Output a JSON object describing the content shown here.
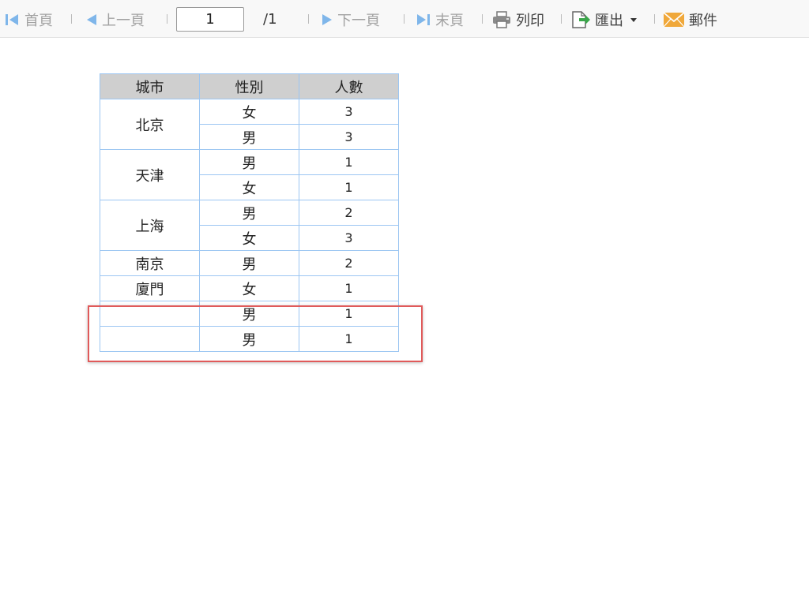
{
  "toolbar": {
    "first_label": "首頁",
    "prev_label": "上一頁",
    "page_input_value": "1",
    "page_total": "/1",
    "next_label": "下一頁",
    "last_label": "末頁",
    "print_label": "列印",
    "export_label": "匯出",
    "mail_label": "郵件"
  },
  "table": {
    "headers": [
      "城市",
      "性別",
      "人數"
    ],
    "groups": [
      {
        "city": "北京",
        "rows": [
          {
            "gender": "女",
            "count": "3"
          },
          {
            "gender": "男",
            "count": "3"
          }
        ]
      },
      {
        "city": "天津",
        "rows": [
          {
            "gender": "男",
            "count": "1"
          },
          {
            "gender": "女",
            "count": "1"
          }
        ]
      },
      {
        "city": "上海",
        "rows": [
          {
            "gender": "男",
            "count": "2"
          },
          {
            "gender": "女",
            "count": "3"
          }
        ]
      },
      {
        "city": "南京",
        "rows": [
          {
            "gender": "男",
            "count": "2"
          }
        ]
      },
      {
        "city": "廈門",
        "rows": [
          {
            "gender": "女",
            "count": "1"
          }
        ]
      },
      {
        "city": "",
        "rows": [
          {
            "gender": "男",
            "count": "1"
          }
        ]
      },
      {
        "city": "",
        "rows": [
          {
            "gender": "男",
            "count": "1"
          }
        ]
      }
    ]
  },
  "colors": {
    "accent_blue": "#7fb6ea",
    "header_bg": "#cfcfcf",
    "grid_border": "#9cc6f2",
    "highlight_red": "#e05a5a",
    "mail_orange": "#f0a83a",
    "export_green": "#3aa64a"
  }
}
